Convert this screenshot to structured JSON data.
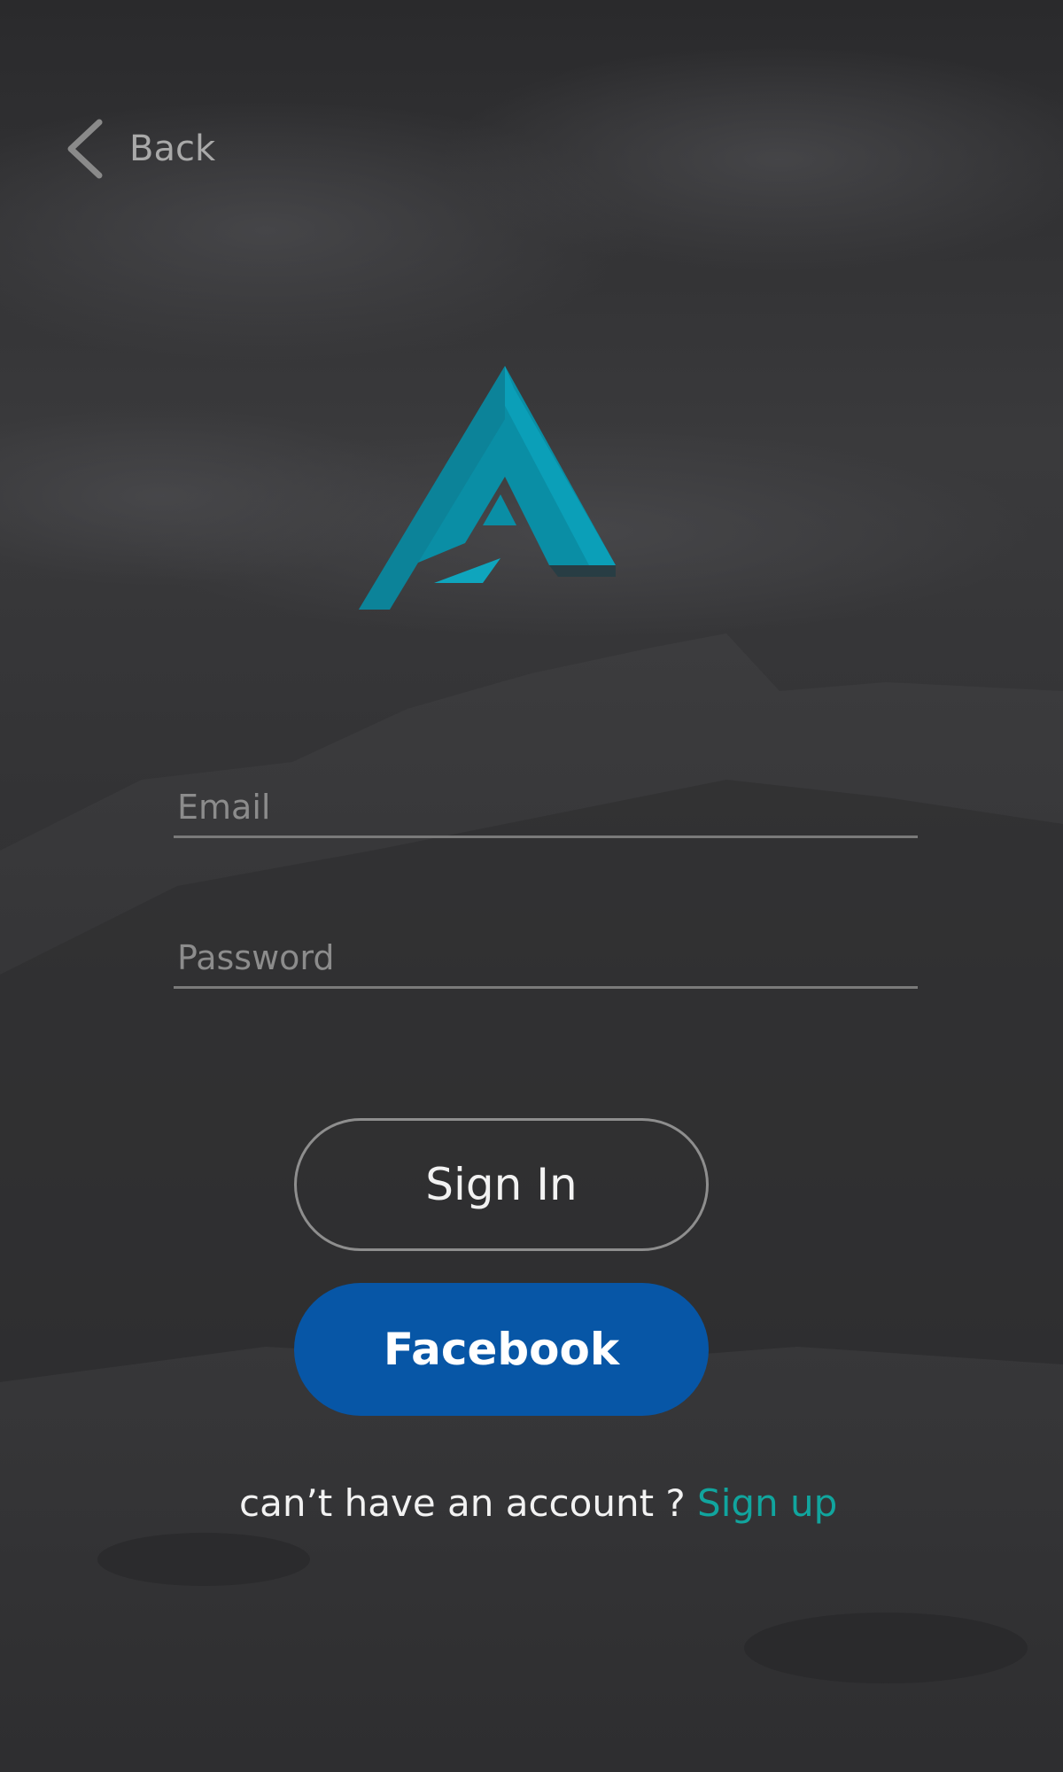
{
  "header": {
    "back_label": "Back",
    "back_icon": "chevron-left-icon"
  },
  "logo": {
    "icon": "logo-a-icon",
    "color": "#0a93ad"
  },
  "form": {
    "email_placeholder": "Email",
    "password_placeholder": "Password"
  },
  "buttons": {
    "signin_label": "Sign In",
    "facebook_label": "Facebook",
    "facebook_color": "#0756a6"
  },
  "footer": {
    "prompt_text": "can’t have an account ? ",
    "signup_label": "Sign up",
    "signup_color": "#11a59e"
  }
}
